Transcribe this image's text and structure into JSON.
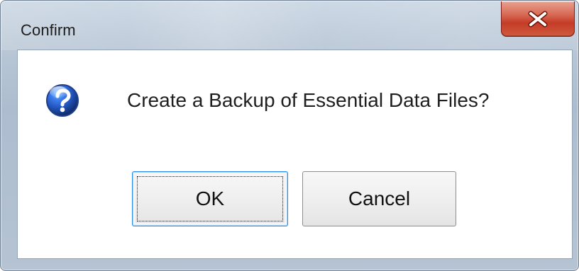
{
  "window": {
    "title": "Confirm"
  },
  "dialog": {
    "message": "Create a Backup of Essential Data Files?",
    "icon": "question-icon"
  },
  "buttons": {
    "ok_label": "OK",
    "cancel_label": "Cancel"
  },
  "colors": {
    "close_button_red": "#c53c26",
    "focus_blue": "#2b8fe6",
    "question_icon_blue": "#1f4fb5"
  }
}
